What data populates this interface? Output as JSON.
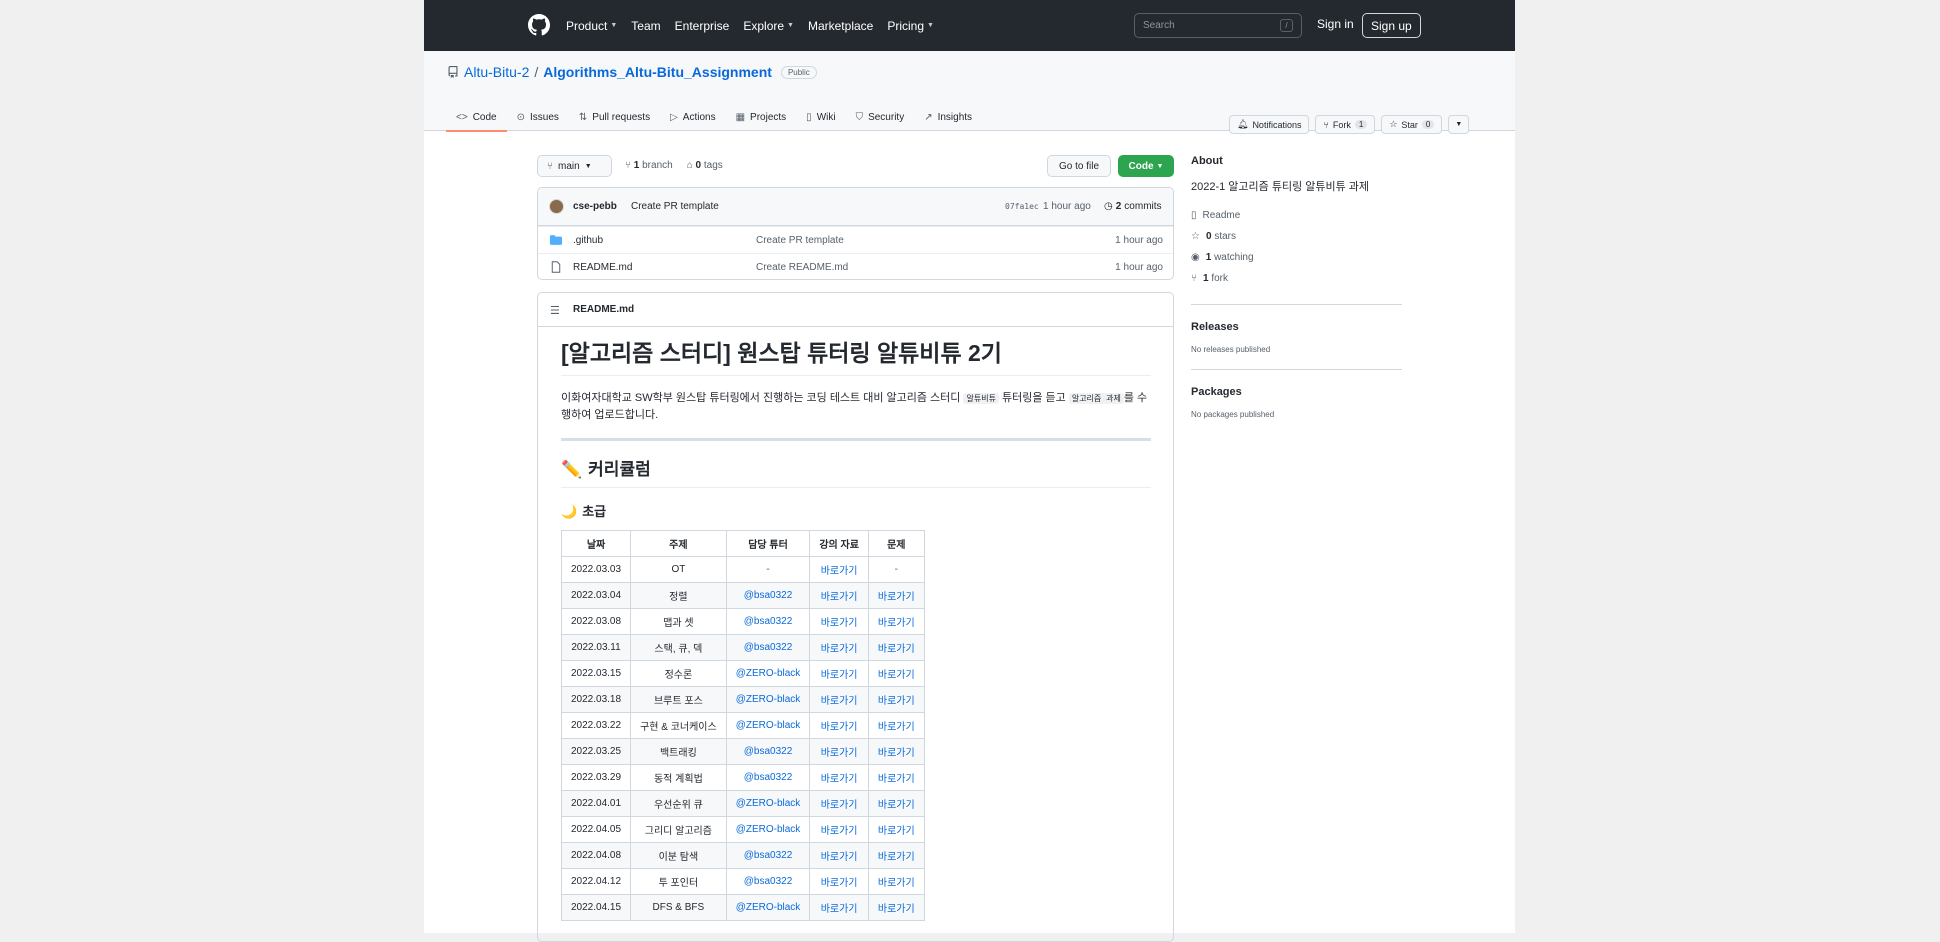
{
  "header": {
    "nav": [
      {
        "label": "Product",
        "caret": true
      },
      {
        "label": "Team",
        "caret": false
      },
      {
        "label": "Enterprise",
        "caret": false
      },
      {
        "label": "Explore",
        "caret": true
      },
      {
        "label": "Marketplace",
        "caret": false
      },
      {
        "label": "Pricing",
        "caret": true
      }
    ],
    "search_placeholder": "Search",
    "search_shortcut": "/",
    "signin": "Sign in",
    "signup": "Sign up"
  },
  "repo": {
    "owner": "Altu-Bitu-2",
    "separator": "/",
    "name": "Algorithms_Altu-Bitu_Assignment",
    "visibility": "Public",
    "notifications": "Notifications",
    "fork": "Fork",
    "fork_count": "1",
    "star": "Star",
    "star_count": "0"
  },
  "tabs": [
    {
      "label": "Code",
      "icon": "code-icon",
      "active": true
    },
    {
      "label": "Issues",
      "icon": "issue-icon",
      "active": false
    },
    {
      "label": "Pull requests",
      "icon": "pull-request-icon",
      "active": false
    },
    {
      "label": "Actions",
      "icon": "play-icon",
      "active": false
    },
    {
      "label": "Projects",
      "icon": "table-icon",
      "active": false
    },
    {
      "label": "Wiki",
      "icon": "book-icon",
      "active": false
    },
    {
      "label": "Security",
      "icon": "shield-icon",
      "active": false
    },
    {
      "label": "Insights",
      "icon": "graph-icon",
      "active": false
    }
  ],
  "branch": {
    "current": "main",
    "branch_count": "1",
    "branch_label": "branch",
    "tag_count": "0",
    "tag_label": "tags",
    "go_to_file": "Go to file",
    "code": "Code"
  },
  "commit": {
    "author": "cse-pebb",
    "message": "Create PR template",
    "hash": "07fa1ec",
    "age": "1 hour ago",
    "count": "2",
    "count_label": "commits"
  },
  "files": [
    {
      "name": ".github",
      "type": "folder",
      "message": "Create PR template",
      "age": "1 hour ago"
    },
    {
      "name": "README.md",
      "type": "file",
      "message": "Create README.md",
      "age": "1 hour ago"
    }
  ],
  "readme": {
    "filename": "README.md",
    "h1": "[알고리즘 스터디] 원스탑 튜터링 알튜비튜 2기",
    "intro_pre": "이화여자대학교 SW학부 원스탑 튜터링에서 진행하는 코딩 테스트 대비 알고리즘 스터디 ",
    "intro_code1": "알튜비튜",
    "intro_mid": " 튜터링을 듣고 ",
    "intro_code2": "알고리즘 과제",
    "intro_post": "를 수행하여 업로드합니다.",
    "h2": "커리큘럼",
    "h3": "초급",
    "table_headers": [
      "날짜",
      "주제",
      "담당 튜터",
      "강의 자료",
      "문제"
    ],
    "table_rows": [
      [
        "2022.03.03",
        "OT",
        "-",
        "바로가기",
        "-"
      ],
      [
        "2022.03.04",
        "정렬",
        "@bsa0322",
        "바로가기",
        "바로가기"
      ],
      [
        "2022.03.08",
        "맵과 셋",
        "@bsa0322",
        "바로가기",
        "바로가기"
      ],
      [
        "2022.03.11",
        "스택, 큐, 덱",
        "@bsa0322",
        "바로가기",
        "바로가기"
      ],
      [
        "2022.03.15",
        "정수론",
        "@ZERO-black",
        "바로가기",
        "바로가기"
      ],
      [
        "2022.03.18",
        "브루트 포스",
        "@ZERO-black",
        "바로가기",
        "바로가기"
      ],
      [
        "2022.03.22",
        "구현 & 코너케이스",
        "@ZERO-black",
        "바로가기",
        "바로가기"
      ],
      [
        "2022.03.25",
        "백트래킹",
        "@bsa0322",
        "바로가기",
        "바로가기"
      ],
      [
        "2022.03.29",
        "동적 계획법",
        "@bsa0322",
        "바로가기",
        "바로가기"
      ],
      [
        "2022.04.01",
        "우선순위 큐",
        "@ZERO-black",
        "바로가기",
        "바로가기"
      ],
      [
        "2022.04.05",
        "그리디 알고리즘",
        "@ZERO-black",
        "바로가기",
        "바로가기"
      ],
      [
        "2022.04.08",
        "이분 탐색",
        "@bsa0322",
        "바로가기",
        "바로가기"
      ],
      [
        "2022.04.12",
        "투 포인터",
        "@bsa0322",
        "바로가기",
        "바로가기"
      ],
      [
        "2022.04.15",
        "DFS & BFS",
        "@ZERO-black",
        "바로가기",
        "바로가기"
      ]
    ]
  },
  "about": {
    "title": "About",
    "description": "2022-1 알고리즘 튜티링 알튜비튜 과제",
    "readme": "Readme",
    "stars_count": "0",
    "stars_label": "stars",
    "watching_count": "1",
    "watching_label": "watching",
    "fork_count": "1",
    "fork_label": "fork"
  },
  "releases": {
    "title": "Releases",
    "empty": "No releases published"
  },
  "packages": {
    "title": "Packages",
    "empty": "No packages published"
  },
  "colors": {
    "header_bg": "#24292f",
    "link": "#0969da",
    "code_button": "#2da44e",
    "active_tab_underline": "#fd8c73"
  }
}
